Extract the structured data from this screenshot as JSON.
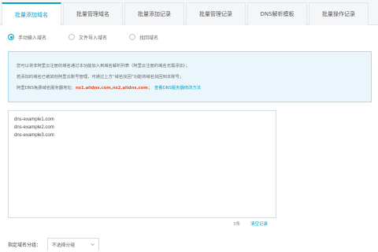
{
  "tabs": [
    {
      "label": "批量添加域名",
      "active": true
    },
    {
      "label": "批量管理域名",
      "active": false
    },
    {
      "label": "批量添加记录",
      "active": false
    },
    {
      "label": "批量管理记录",
      "active": false
    },
    {
      "label": "DNS解析模板",
      "active": false
    },
    {
      "label": "批量操作记录",
      "active": false
    }
  ],
  "input_mode": {
    "options": [
      {
        "label": "手动输入域名",
        "checked": true
      },
      {
        "label": "文件导入域名",
        "checked": false
      },
      {
        "label": "找回域名",
        "checked": false
      }
    ]
  },
  "notice": {
    "line1": "您可以将非阿里云注册的域名通过本功能加入到域名解析列表（阿里云注册的域名无需添加）；",
    "line2": "若添加的域名已被其他阿里云账号管理，可通过上方“域名找回”功能将域名找回到本账号；",
    "line3_prefix": "阿里DNS免费域名服务器地址：",
    "dns_servers": "ns1.alidns.com,ns2.alidns.com",
    "line3_suffix": "；",
    "link": "查看DNS服务器修改方法"
  },
  "domain_input": {
    "lines": [
      "dns-example1.com",
      "dns-example2.com",
      "dns-example3.com"
    ]
  },
  "footer": {
    "count": "3条",
    "clear_label": "清空记录"
  },
  "group": {
    "label": "指定域名分组：",
    "selected": "不选择分组"
  },
  "colors": {
    "accent": "#00a2ca",
    "dns_highlight": "#e0502e",
    "notice_bg": "#eaf6fb"
  }
}
